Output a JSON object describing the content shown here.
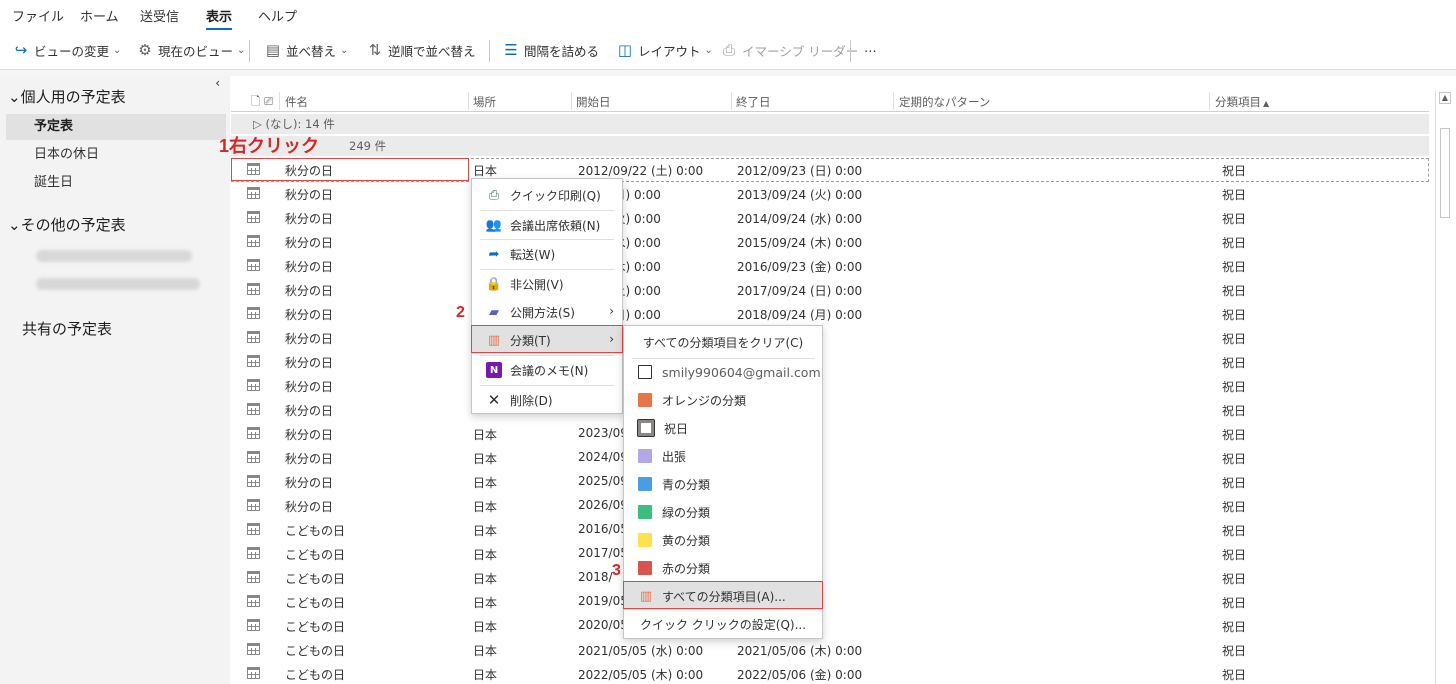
{
  "menu": {
    "tabs": [
      "ファイル",
      "ホーム",
      "送受信",
      "表示",
      "ヘルプ"
    ],
    "active": "表示"
  },
  "ribbon": {
    "change_view": "ビューの変更",
    "current_view": "現在のビュー",
    "sort": "並べ替え",
    "reverse_sort": "逆順で並べ替え",
    "compact": "間隔を詰める",
    "layout": "レイアウト",
    "immersive_reader": "イマーシブ リーダー",
    "more": "⋯"
  },
  "sidebar": {
    "collapse": "‹",
    "my_calendars": "個人用の予定表",
    "items": [
      "予定表",
      "日本の休日",
      "誕生日"
    ],
    "other_calendars": "その他の予定表",
    "shared": "共有の予定表"
  },
  "columns": {
    "subject": "件名",
    "location": "場所",
    "start": "開始日",
    "end": "終了日",
    "recurrence": "定期的なパターン",
    "category": "分類項目"
  },
  "groups": {
    "none": "(なし): 14 件",
    "second": "249 件"
  },
  "rows": [
    {
      "subject": "秋分の日",
      "location": "日本",
      "start": "2012/09/22 (土) 0:00",
      "end": "2012/09/23 (日) 0:00",
      "category": "祝日"
    },
    {
      "subject": "秋分の日",
      "location": "",
      "start": "9/23 (月) 0:00",
      "end": "2013/09/24 (火) 0:00",
      "category": "祝日"
    },
    {
      "subject": "秋分の日",
      "location": "",
      "start": "9/23 (火) 0:00",
      "end": "2014/09/24 (水) 0:00",
      "category": "祝日"
    },
    {
      "subject": "秋分の日",
      "location": "",
      "start": "9/23 (水) 0:00",
      "end": "2015/09/24 (木) 0:00",
      "category": "祝日"
    },
    {
      "subject": "秋分の日",
      "location": "",
      "start": "9/22 (木) 0:00",
      "end": "2016/09/23 (金) 0:00",
      "category": "祝日"
    },
    {
      "subject": "秋分の日",
      "location": "",
      "start": "9/23 (土) 0:00",
      "end": "2017/09/24 (日) 0:00",
      "category": "祝日"
    },
    {
      "subject": "秋分の日",
      "location": "",
      "start": "9/23 (日) 0:00",
      "end": "2018/09/24 (月) 0:00",
      "category": "祝日"
    },
    {
      "subject": "秋分の日",
      "location": "",
      "start": "",
      "end": ") 0:00",
      "category": "祝日"
    },
    {
      "subject": "秋分の日",
      "location": "",
      "start": "",
      "end": ") 0:00",
      "category": "祝日"
    },
    {
      "subject": "秋分の日",
      "location": "",
      "start": "",
      "end": ") 0:00",
      "category": "祝日"
    },
    {
      "subject": "秋分の日",
      "location": "",
      "start": "",
      "end": ") 0:00",
      "category": "祝日"
    },
    {
      "subject": "秋分の日",
      "location": "日本",
      "start": "2023/09",
      "end": ") 0:00",
      "category": "祝日"
    },
    {
      "subject": "秋分の日",
      "location": "日本",
      "start": "2024/09",
      "end": ") 0:00",
      "category": "祝日"
    },
    {
      "subject": "秋分の日",
      "location": "日本",
      "start": "2025/09",
      "end": ") 0:00",
      "category": "祝日"
    },
    {
      "subject": "秋分の日",
      "location": "日本",
      "start": "2026/09",
      "end": ") 0:00",
      "category": "祝日"
    },
    {
      "subject": "こどもの日",
      "location": "日本",
      "start": "2016/05",
      "end": ") 0:00",
      "category": "祝日"
    },
    {
      "subject": "こどもの日",
      "location": "日本",
      "start": "2017/05",
      "end": ") 0:00",
      "category": "祝日"
    },
    {
      "subject": "こどもの日",
      "location": "日本",
      "start": "2018/",
      "end": ") 0:00",
      "category": "祝日"
    },
    {
      "subject": "こどもの日",
      "location": "日本",
      "start": "2019/05",
      "end": ") 0:00",
      "category": "祝日"
    },
    {
      "subject": "こどもの日",
      "location": "日本",
      "start": "2020/05",
      "end": ") 0:00",
      "category": "祝日"
    },
    {
      "subject": "こどもの日",
      "location": "日本",
      "start": "2021/05/05 (水) 0:00",
      "end": "2021/05/06 (木) 0:00",
      "category": "祝日"
    },
    {
      "subject": "こどもの日",
      "location": "日本",
      "start": "2022/05/05 (木) 0:00",
      "end": "2022/05/06 (金) 0:00",
      "category": "祝日"
    }
  ],
  "context_menu": {
    "items": [
      {
        "label": "クイック印刷(Q)",
        "icon": "printer-icon"
      },
      {
        "label": "会議出席依頼(N)",
        "icon": "people-icon"
      },
      {
        "label": "転送(W)",
        "icon": "forward-icon"
      },
      {
        "label": "非公開(V)",
        "icon": "lock-icon"
      },
      {
        "label": "公開方法(S)",
        "icon": "publish-icon"
      },
      {
        "label": "分類(T)",
        "icon": "category-icon"
      },
      {
        "label": "会議のメモ(N)",
        "icon": "onenote-icon"
      },
      {
        "label": "削除(D)",
        "icon": "delete-icon"
      }
    ]
  },
  "category_menu": {
    "clear": "すべての分類項目をクリア(C)",
    "categories": [
      {
        "label": "smily990604@gmail.com",
        "color": "none"
      },
      {
        "label": "オレンジの分類",
        "color": "#e8744a"
      },
      {
        "label": "祝日",
        "color": "holiday"
      },
      {
        "label": "出張",
        "color": "#b4a7e5"
      },
      {
        "label": "青の分類",
        "color": "#4a9de0"
      },
      {
        "label": "緑の分類",
        "color": "#3dbd7d"
      },
      {
        "label": "黄の分類",
        "color": "#ffe14d"
      },
      {
        "label": "赤の分類",
        "color": "#d9534f"
      }
    ],
    "all": "すべての分類項目(A)...",
    "quick_click": "クイック クリックの設定(Q)..."
  },
  "annotations": {
    "step1": "1右クリック",
    "step2": "2",
    "step3": "3"
  }
}
